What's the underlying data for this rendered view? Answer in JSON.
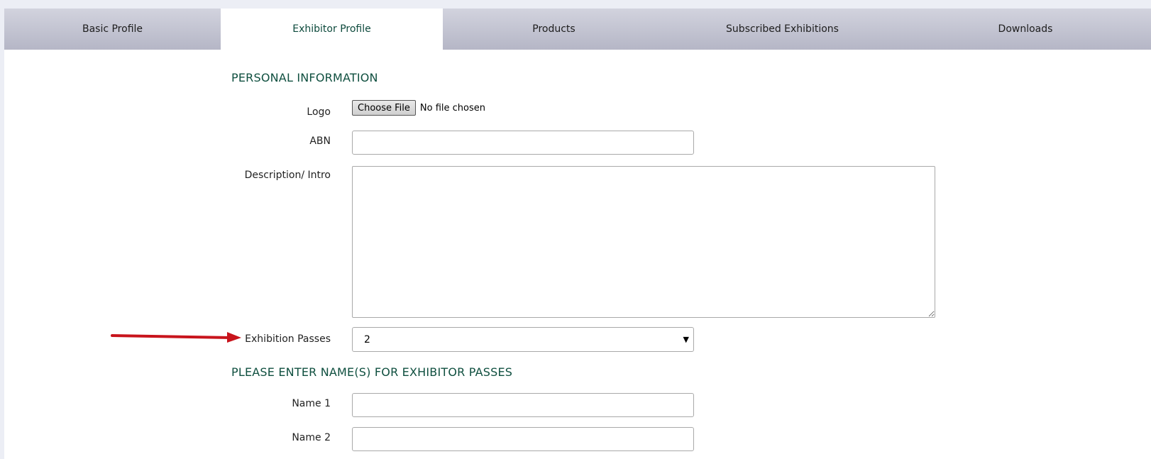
{
  "tabs": [
    {
      "label": "Basic Profile"
    },
    {
      "label": "Exhibitor Profile",
      "active": true
    },
    {
      "label": "Products"
    },
    {
      "label": "Subscribed Exhibitions"
    },
    {
      "label": "Downloads"
    }
  ],
  "personal": {
    "title": "PERSONAL INFORMATION",
    "logo_label": "Logo",
    "file_button": "Choose File",
    "file_status": "No file chosen",
    "abn_label": "ABN",
    "abn_value": "",
    "description_label": "Description/ Intro",
    "description_value": "",
    "passes_label": "Exhibition Passes",
    "passes_value": "2"
  },
  "names": {
    "title": "PLEASE ENTER NAME(S) FOR EXHIBITOR PASSES",
    "name1_label": "Name 1",
    "name1_value": "",
    "name2_label": "Name 2",
    "name2_value": ""
  },
  "colors": {
    "accent": "#0f4f3f",
    "arrow": "#c8141c"
  }
}
